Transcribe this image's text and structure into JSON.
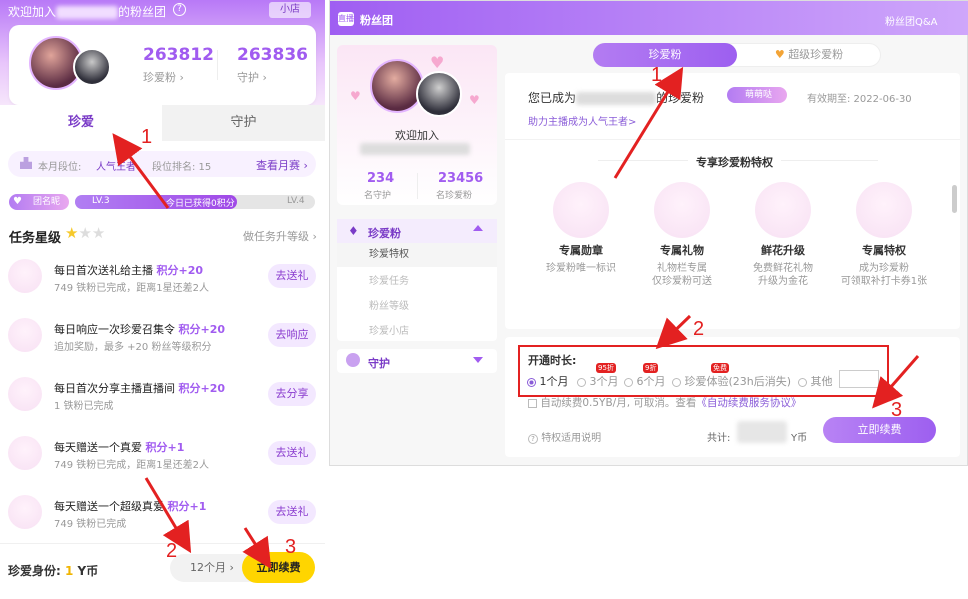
{
  "left": {
    "welcome_prefix": "欢迎加入",
    "welcome_suffix": "的粉丝团",
    "shop": "小店",
    "count_fans": "263812",
    "fans_label": "珍爱粉",
    "count_guard": "263836",
    "guard_label": "守护",
    "tab_love": "珍爱",
    "tab_guard": "守护",
    "month_level_label": "本月段位:",
    "month_level_value": "人气王者",
    "rank_label": "段位排名: 15",
    "view_monthly": "查看月赛",
    "group_name": "团名昵",
    "lv_current": "LV.3",
    "today_points": "今日已获得0积分",
    "lv_next": "LV.4",
    "task_title": "任务星级",
    "task_more": "做任务升等级",
    "tasks": [
      {
        "title": "每日首次送礼给主播",
        "points": "积分+20",
        "sub": "749 铁粉已完成，距离1星还差2人",
        "action": "去送礼"
      },
      {
        "title": "每日响应一次珍爱召集令",
        "points": "积分+20",
        "sub": "追加奖励，最多 +20 粉丝等级积分",
        "action": "去响应"
      },
      {
        "title": "每日首次分享主播直播间",
        "points": "积分+20",
        "sub": "1 铁粉已完成",
        "action": "去分享"
      },
      {
        "title": "每天赠送一个真爱",
        "points": "积分+1",
        "sub": "749 铁粉已完成，距离1星还差2人",
        "action": "去送礼"
      },
      {
        "title": "每天赠送一个超级真爱",
        "points": "积分+1",
        "sub": "749 铁粉已完成",
        "action": "去送礼"
      }
    ],
    "identity_label": "珍爱身份:",
    "identity_value": "1",
    "identity_unit": "Y币",
    "duration": "12个月",
    "renew": "立即续费"
  },
  "right": {
    "logo": "直播",
    "title": "粉丝团",
    "qa": "粉丝团Q&A",
    "tab_love": "珍爱粉",
    "tab_super": "超级珍爱粉",
    "profile_welcome": "欢迎加入",
    "stat_guard_num": "234",
    "stat_guard_label": "名守护",
    "stat_fans_num": "23456",
    "stat_fans_label": "名珍爱粉",
    "nav_love": "珍爱粉",
    "nav_items": [
      "珍爱特权",
      "珍爱任务",
      "粉丝等级",
      "珍爱小店"
    ],
    "nav_guard": "守护",
    "became_prefix": "您已成为",
    "became_suffix": "的珍爱粉",
    "badge": "萌萌哒",
    "valid": "有效期至: 2022-06-30",
    "help_link": "助力主播成为人气王者>",
    "privileges_title": "专享珍爱粉特权",
    "privileges": [
      {
        "name": "专属勋章",
        "desc1": "珍爱粉唯一标识",
        "desc2": ""
      },
      {
        "name": "专属礼物",
        "desc1": "礼物栏专属",
        "desc2": "仅珍爱粉可送"
      },
      {
        "name": "鲜花升级",
        "desc1": "免费鲜花礼物",
        "desc2": "升级为金花"
      },
      {
        "name": "专属特权",
        "desc1": "成为珍爱粉",
        "desc2": "可领取补打卡券1张"
      }
    ],
    "duration_label": "开通时长:",
    "options": [
      "1个月",
      "3个月",
      "6个月",
      "珍爱体验",
      "其他"
    ],
    "trial_note": "(23h后消失)",
    "option_tags": [
      "95折",
      "9折",
      "免费"
    ],
    "auto_renew": "自动续费0.5YB/月, 可取消。查看",
    "auto_renew_link": "《自动续费服务协议》",
    "privilege_note": "特权适用说明",
    "total_label": "共计:",
    "total_unit": "Y币",
    "renew": "立即续费"
  },
  "annotations": [
    "1",
    "2",
    "3",
    "1",
    "2",
    "3"
  ],
  "colors": {
    "purple": "#a15cf0",
    "accent": "#8a3ccf",
    "yellow": "#ffd500",
    "red": "#e32121"
  }
}
